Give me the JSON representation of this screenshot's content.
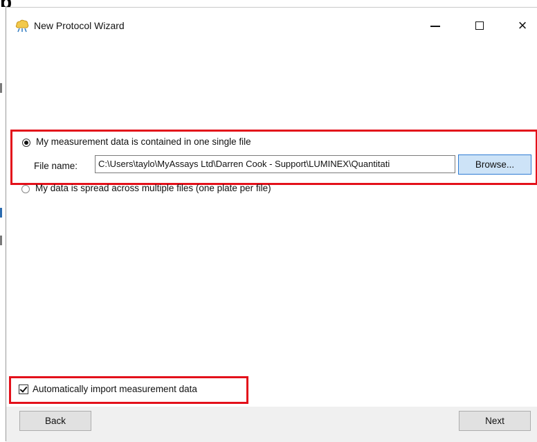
{
  "window": {
    "title": "New Protocol Wizard",
    "app_icon": "wizard-icon",
    "controls": {
      "minimize": "minimize-icon",
      "maximize": "maximize-icon",
      "close": "×"
    }
  },
  "source_options": {
    "single_file_label": "My measurement data is contained in one single file",
    "single_file_selected": true,
    "file_name_label": "File name:",
    "file_name_value": "C:\\Users\\taylo\\MyAssays Ltd\\Darren Cook - Support\\LUMINEX\\Quantitati",
    "browse_label": "Browse...",
    "multi_file_label": "My data is spread across multiple files (one plate per file)",
    "multi_file_selected": false
  },
  "auto_import": {
    "label": "Automatically import measurement data",
    "checked": true
  },
  "footer": {
    "back_label": "Back",
    "next_label": "Next"
  },
  "colors": {
    "highlight": "#e3101a",
    "browse_bg": "#cde3f7",
    "browse_border": "#2d7bd3",
    "footer_bg": "#f0f0f0"
  }
}
